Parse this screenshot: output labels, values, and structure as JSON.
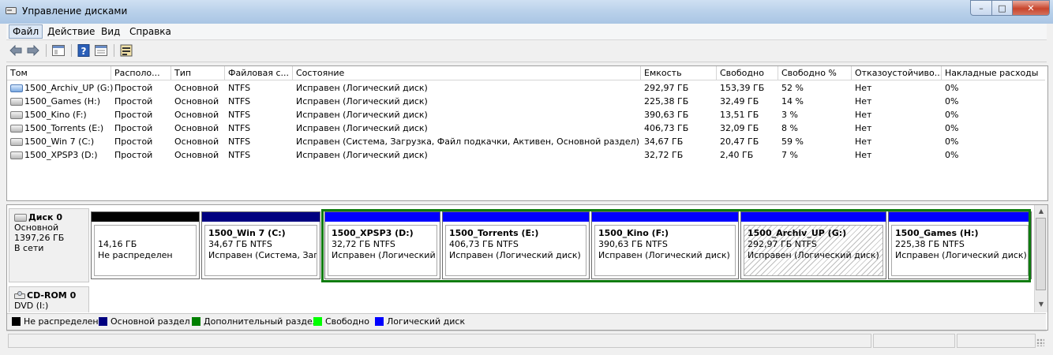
{
  "window": {
    "title": "Управление дисками",
    "min": "–",
    "max": "□",
    "close": "✕"
  },
  "menu": [
    "Файл",
    "Действие",
    "Вид",
    "Справка"
  ],
  "columns": [
    "Том",
    "Располо...",
    "Тип",
    "Файловая с...",
    "Состояние",
    "Емкость",
    "Свободно",
    "Свободно %",
    "Отказоустойчиво...",
    "Накладные расходы"
  ],
  "volumes": [
    {
      "name": "1500_Archiv_UP (G:)",
      "layout": "Простой",
      "type": "Основной",
      "fs": "NTFS",
      "status": "Исправен (Логический диск)",
      "capacity": "292,97 ГБ",
      "free": "153,39 ГБ",
      "free_pct": "52 %",
      "fault": "Нет",
      "overhead": "0%"
    },
    {
      "name": "1500_Games (H:)",
      "layout": "Простой",
      "type": "Основной",
      "fs": "NTFS",
      "status": "Исправен (Логический диск)",
      "capacity": "225,38 ГБ",
      "free": "32,49 ГБ",
      "free_pct": "14 %",
      "fault": "Нет",
      "overhead": "0%"
    },
    {
      "name": "1500_Kino (F:)",
      "layout": "Простой",
      "type": "Основной",
      "fs": "NTFS",
      "status": "Исправен (Логический диск)",
      "capacity": "390,63 ГБ",
      "free": "13,51 ГБ",
      "free_pct": "3 %",
      "fault": "Нет",
      "overhead": "0%"
    },
    {
      "name": "1500_Torrents (E:)",
      "layout": "Простой",
      "type": "Основной",
      "fs": "NTFS",
      "status": "Исправен (Логический диск)",
      "capacity": "406,73 ГБ",
      "free": "32,09 ГБ",
      "free_pct": "8 %",
      "fault": "Нет",
      "overhead": "0%"
    },
    {
      "name": "1500_Win 7 (C:)",
      "layout": "Простой",
      "type": "Основной",
      "fs": "NTFS",
      "status": "Исправен (Система, Загрузка, Файл подкачки, Активен, Основной раздел)",
      "capacity": "34,67 ГБ",
      "free": "20,47 ГБ",
      "free_pct": "59 %",
      "fault": "Нет",
      "overhead": "0%"
    },
    {
      "name": "1500_XPSP3 (D:)",
      "layout": "Простой",
      "type": "Основной",
      "fs": "NTFS",
      "status": "Исправен (Логический диск)",
      "capacity": "32,72 ГБ",
      "free": "2,40 ГБ",
      "free_pct": "7 %",
      "fault": "Нет",
      "overhead": "0%"
    }
  ],
  "disk0": {
    "label": "Диск 0",
    "kind": "Основной",
    "size": "1397,26 ГБ",
    "state": "В сети",
    "partitions": [
      {
        "name": "",
        "size": "14,16 ГБ",
        "status": "Не распределен",
        "strip": "#000000"
      },
      {
        "name": "1500_Win 7  (C:)",
        "size": "34,67 ГБ NTFS",
        "status": "Исправен (Система, Загр",
        "strip": "#000080"
      },
      {
        "name": "1500_XPSP3  (D:)",
        "size": "32,72 ГБ NTFS",
        "status": "Исправен (Логический ,",
        "strip": "#0000ff"
      },
      {
        "name": "1500_Torrents  (E:)",
        "size": "406,73 ГБ NTFS",
        "status": "Исправен (Логический диск)",
        "strip": "#0000ff"
      },
      {
        "name": "1500_Kino  (F:)",
        "size": "390,63 ГБ NTFS",
        "status": "Исправен (Логический диск)",
        "strip": "#0000ff"
      },
      {
        "name": "1500_Archiv_UP  (G:)",
        "size": "292,97 ГБ NTFS",
        "status": "Исправен (Логический диск)",
        "strip": "#0000ff"
      },
      {
        "name": "1500_Games  (H:)",
        "size": "225,38 ГБ NTFS",
        "status": "Исправен (Логический диск)",
        "strip": "#0000ff"
      }
    ]
  },
  "cdrom": {
    "label": "CD-ROM 0",
    "drive": "DVD (I:)"
  },
  "legend": [
    {
      "label": "Не распределен",
      "color": "#000000"
    },
    {
      "label": "Основной раздел",
      "color": "#000080"
    },
    {
      "label": "Дополнительный раздел",
      "color": "#008000"
    },
    {
      "label": "Свободно",
      "color": "#00ff00"
    },
    {
      "label": "Логический диск",
      "color": "#0000ff"
    }
  ]
}
